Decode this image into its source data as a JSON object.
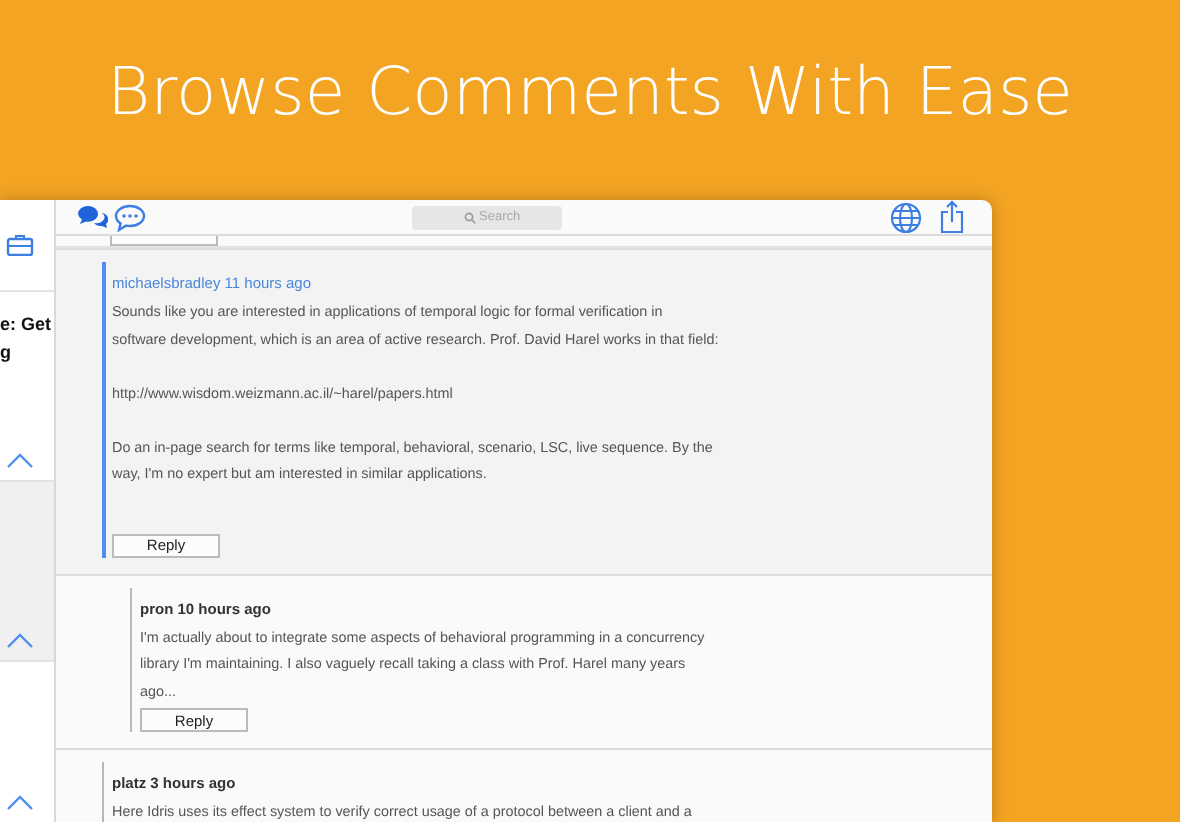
{
  "headline": "Browse Comments With Ease",
  "sidebar": {
    "items": [
      {
        "title_lines": [
          "e: Get",
          "g"
        ],
        "selected": false
      },
      {
        "selected": true
      },
      {
        "selected": false
      }
    ]
  },
  "toolbar": {
    "search": {
      "placeholder": "Search"
    }
  },
  "comments": [
    {
      "author": "michaelsbradley",
      "time": "11 hours ago",
      "selected": true,
      "paragraphs": [
        [
          "Sounds like you are interested in applications of temporal logic for formal verification in",
          "software development, which is an area of active research. Prof. David Harel works in that field:"
        ],
        [
          "http://www.wisdom.weizmann.ac.il/~harel/papers.html"
        ],
        [
          "Do an in-page search for terms like temporal, behavioral, scenario, LSC, live sequence. By the",
          "way, I'm no expert but am interested in similar applications."
        ]
      ],
      "reply": "Reply",
      "children": [
        {
          "author": "pron",
          "time": "10 hours ago",
          "selected": false,
          "paragraphs": [
            [
              "I'm actually about to integrate some aspects of behavioral programming in a concurrency",
              "library I'm maintaining. I also vaguely recall taking a class with Prof. Harel many years",
              "ago..."
            ]
          ],
          "reply": "Reply"
        }
      ]
    },
    {
      "author": "platz",
      "time": "3 hours ago",
      "selected": false,
      "paragraphs": [
        [
          "Here Idris uses its effect system to verify correct usage of a protocol between a client and a"
        ]
      ]
    }
  ]
}
